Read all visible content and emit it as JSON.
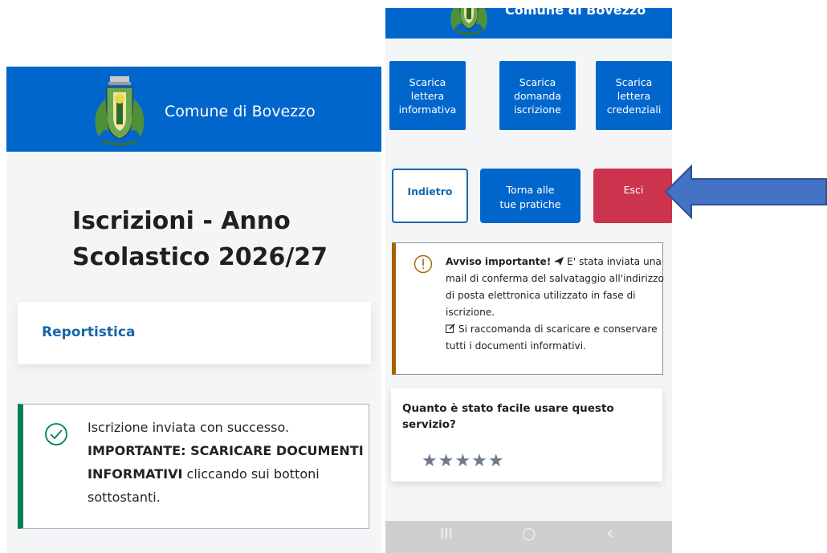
{
  "left": {
    "brand": "Comune di Bovezzo",
    "title": "Iscrizioni - Anno Scolastico 2026/27",
    "report_label": "Reportistica",
    "success": {
      "text1": "Iscrizione inviata con successo.",
      "bold": "IMPORTANTE: SCARICARE DOCUMENTI INFORMATIVI",
      "text2": " cliccando sui bottoni sottostanti."
    }
  },
  "right": {
    "brand": "Comune di Bovezzo",
    "download_buttons": [
      {
        "l1": "Scarica",
        "l2": "lettera",
        "l3": "informativa"
      },
      {
        "l1": "Scarica",
        "l2": "domanda",
        "l3": "iscrizione"
      },
      {
        "l1": "Scarica",
        "l2": "lettera",
        "l3": "credenziali"
      }
    ],
    "nav_buttons": {
      "back": "Indietro",
      "practices_l1": "Torna alle",
      "practices_l2": "tue pratiche",
      "exit": "Esci"
    },
    "notice": {
      "bold": "Avviso importante!",
      "text1": " E' stata inviata una mail di conferma del salvataggio all'indirizzo di posta elettronica utilizzato in fase di iscrizione.",
      "text2": " Si raccomanda di scaricare e conservare tutti i documenti informativi."
    },
    "rating": {
      "question": "Quanto è stato facile usare questo servizio?",
      "stars": "★★★★★"
    },
    "system_nav": {
      "recent": "III",
      "home": "○",
      "back": "‹"
    }
  },
  "colors": {
    "header_blue": "#0066cc",
    "exit_red": "#cc334d",
    "success_green": "#008055",
    "warning_brown": "#a66300",
    "arrow_blue": "#4472c4"
  },
  "icons": [
    "municipal-crest-icon",
    "check-circle-icon",
    "alert-circle-icon",
    "paper-plane-icon",
    "edit-icon",
    "star-icon",
    "arrow-left-icon"
  ]
}
